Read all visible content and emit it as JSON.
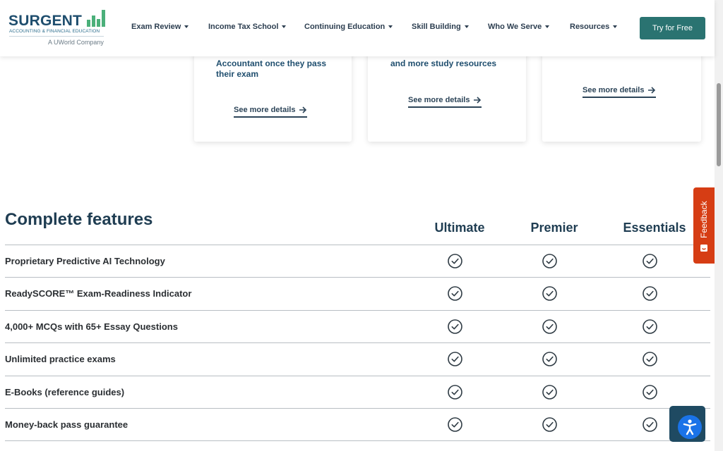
{
  "header": {
    "logo": {
      "wordmark": "SURGENT",
      "tagline": "ACCOUNTING & FINANCIAL EDUCATION",
      "company": "A UWorld Company",
      "bar_color": "#4bb07a"
    },
    "nav": [
      {
        "label": "Exam Review"
      },
      {
        "label": "Income Tax School"
      },
      {
        "label": "Continuing Education"
      },
      {
        "label": "Skill Building"
      },
      {
        "label": "Who We Serve"
      },
      {
        "label": "Resources"
      }
    ],
    "cta_label": "Try for Free",
    "cta_color": "#2a7371"
  },
  "cards": [
    {
      "text": [
        "Accountant once they pass",
        "their exam"
      ],
      "link": "See more details"
    },
    {
      "text": [
        "and more study resources"
      ],
      "link": "See more details"
    },
    {
      "text": [],
      "link": "See more details"
    }
  ],
  "features": {
    "title": "Complete features",
    "plans": [
      "Ultimate",
      "Premier",
      "Essentials"
    ],
    "rows": [
      {
        "label": "Proprietary Predictive AI Technology",
        "included": [
          true,
          true,
          true
        ]
      },
      {
        "label": "ReadySCORE™ Exam-Readiness Indicator",
        "included": [
          true,
          true,
          true
        ]
      },
      {
        "label": "4,000+ MCQs with 65+ Essay Questions",
        "included": [
          true,
          true,
          true
        ]
      },
      {
        "label": "Unlimited practice exams",
        "included": [
          true,
          true,
          true
        ]
      },
      {
        "label": "E-Books (reference guides)",
        "included": [
          true,
          true,
          true
        ]
      },
      {
        "label": "Money-back pass guarantee",
        "included": [
          true,
          true,
          true
        ]
      }
    ]
  },
  "feedback_label": "Feedback",
  "feedback_color": "#d63d14",
  "accessibility_icon": "accessibility-icon"
}
